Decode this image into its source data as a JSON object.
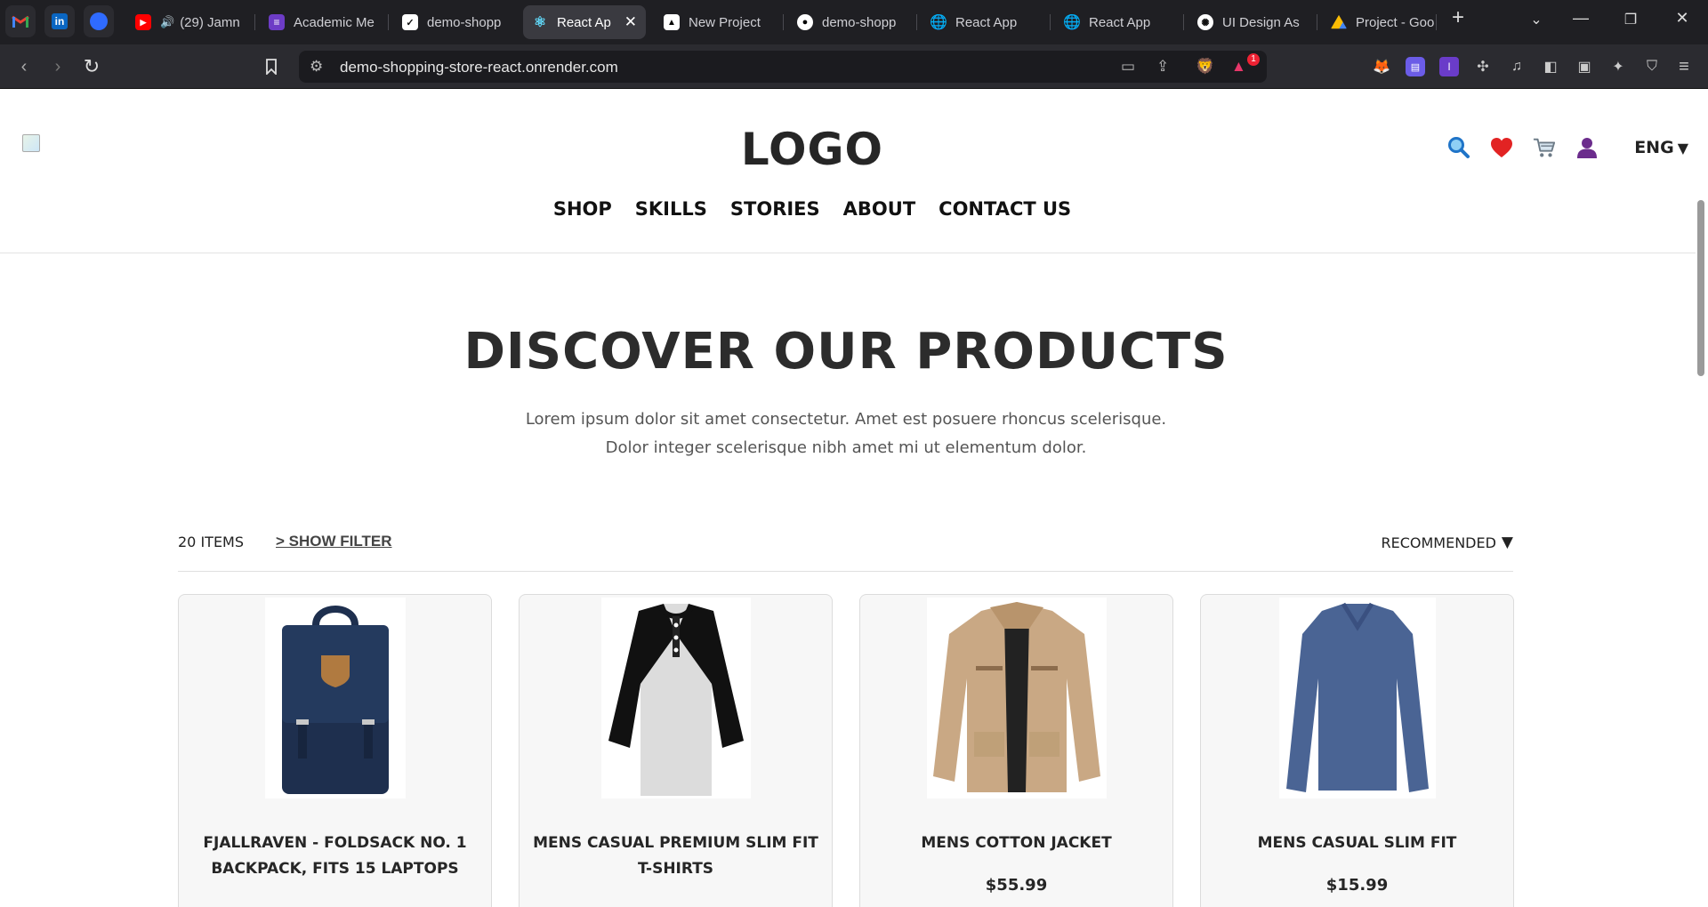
{
  "browser": {
    "tabs": [
      {
        "title": "(29) Jamn",
        "favicon": "youtube-icon",
        "audio": true
      },
      {
        "title": "Academic Me",
        "favicon": "list-icon"
      },
      {
        "title": "demo-shopp",
        "favicon": "render-icon"
      },
      {
        "title": "React Ap",
        "favicon": "react-icon",
        "active": true
      },
      {
        "title": "New Project",
        "favicon": "vercel-icon"
      },
      {
        "title": "demo-shopp",
        "favicon": "github-icon"
      },
      {
        "title": "React App",
        "favicon": "globe-icon"
      },
      {
        "title": "React App",
        "favicon": "globe-icon"
      },
      {
        "title": "UI Design As",
        "favicon": "openai-icon"
      },
      {
        "title": "Project - Goo",
        "favicon": "drive-icon"
      }
    ],
    "address": "demo-shopping-store-react.onrender.com",
    "notification_count": "1"
  },
  "header": {
    "logo_text": "LOGO",
    "language": "ENG",
    "nav": [
      "SHOP",
      "SKILLS",
      "STORIES",
      "ABOUT",
      "CONTACT US"
    ]
  },
  "hero": {
    "title": "DISCOVER OUR PRODUCTS",
    "subtitle_line1": "Lorem ipsum dolor sit amet consectetur. Amet est posuere rhoncus scelerisque.",
    "subtitle_line2": "Dolor integer scelerisque nibh amet mi ut elementum dolor."
  },
  "filter": {
    "items_count": "20 ITEMS",
    "show_filter": "> SHOW FILTER",
    "sort_label": "RECOMMENDED"
  },
  "products": [
    {
      "name": "FJALLRAVEN - FOLDSACK NO. 1 BACKPACK, FITS 15 LAPTOPS",
      "price": "",
      "image": "backpack"
    },
    {
      "name": "MENS CASUAL PREMIUM SLIM FIT T-SHIRTS",
      "price": "",
      "image": "raglan-shirt"
    },
    {
      "name": "MENS COTTON JACKET",
      "price": "$55.99",
      "image": "jacket"
    },
    {
      "name": "MENS CASUAL SLIM FIT",
      "price": "$15.99",
      "image": "longsleeve-shirt"
    }
  ],
  "colors": {
    "accent_heart": "#e22323",
    "search_icon": "#1f74c8",
    "user_icon": "#6b2c8c",
    "backpack": "#1e2f4e",
    "jacket": "#c9a884",
    "sweater": "#4a6494"
  }
}
